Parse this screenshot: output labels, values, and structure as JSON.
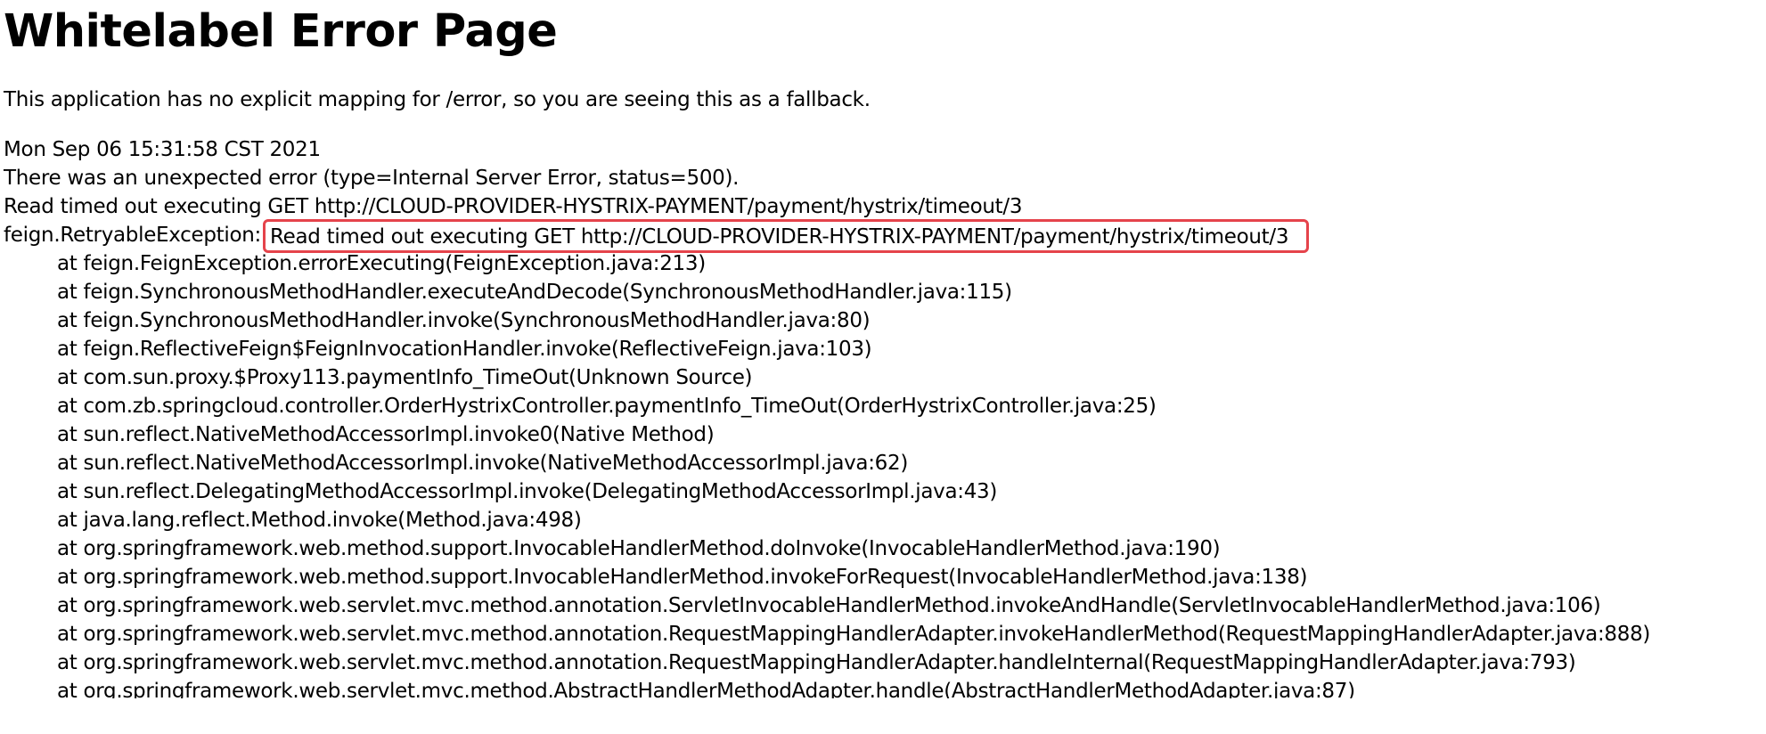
{
  "page": {
    "title": "Whitelabel Error Page",
    "message": "This application has no explicit mapping for /error, so you are seeing this as a fallback."
  },
  "error": {
    "timestamp": "Mon Sep 06 15:31:58 CST 2021",
    "summary": "There was an unexpected error (type=Internal Server Error, status=500).",
    "detail": "Read timed out executing GET http://CLOUD-PROVIDER-HYSTRIX-PAYMENT/payment/hystrix/timeout/3",
    "exception_class": "feign.RetryableException:",
    "exception_message": "Read timed out executing GET http://CLOUD-PROVIDER-HYSTRIX-PAYMENT/payment/hystrix/timeout/3",
    "highlight_color": "#e5434b",
    "frames": [
      "at feign.FeignException.errorExecuting(FeignException.java:213)",
      "at feign.SynchronousMethodHandler.executeAndDecode(SynchronousMethodHandler.java:115)",
      "at feign.SynchronousMethodHandler.invoke(SynchronousMethodHandler.java:80)",
      "at feign.ReflectiveFeign$FeignInvocationHandler.invoke(ReflectiveFeign.java:103)",
      "at com.sun.proxy.$Proxy113.paymentInfo_TimeOut(Unknown Source)",
      "at com.zb.springcloud.controller.OrderHystrixController.paymentInfo_TimeOut(OrderHystrixController.java:25)",
      "at sun.reflect.NativeMethodAccessorImpl.invoke0(Native Method)",
      "at sun.reflect.NativeMethodAccessorImpl.invoke(NativeMethodAccessorImpl.java:62)",
      "at sun.reflect.DelegatingMethodAccessorImpl.invoke(DelegatingMethodAccessorImpl.java:43)",
      "at java.lang.reflect.Method.invoke(Method.java:498)",
      "at org.springframework.web.method.support.InvocableHandlerMethod.doInvoke(InvocableHandlerMethod.java:190)",
      "at org.springframework.web.method.support.InvocableHandlerMethod.invokeForRequest(InvocableHandlerMethod.java:138)",
      "at org.springframework.web.servlet.mvc.method.annotation.ServletInvocableHandlerMethod.invokeAndHandle(ServletInvocableHandlerMethod.java:106)",
      "at org.springframework.web.servlet.mvc.method.annotation.RequestMappingHandlerAdapter.invokeHandlerMethod(RequestMappingHandlerAdapter.java:888)",
      "at org.springframework.web.servlet.mvc.method.annotation.RequestMappingHandlerAdapter.handleInternal(RequestMappingHandlerAdapter.java:793)",
      "at org.springframework.web.servlet.mvc.method.AbstractHandlerMethodAdapter.handle(AbstractHandlerMethodAdapter.java:87)"
    ]
  }
}
